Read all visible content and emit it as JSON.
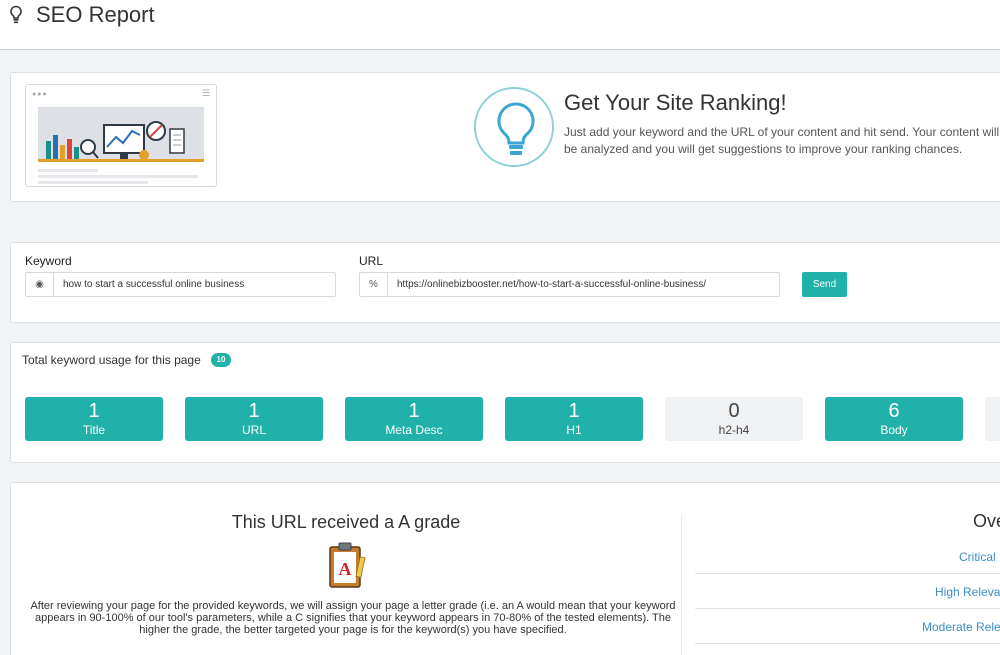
{
  "header": {
    "title": "SEO Report"
  },
  "hero": {
    "title": "Get Your Site Ranking!",
    "description": "Just add your keyword and the URL of your content and hit send. Your content will be analyzed and you will get suggestions to improve your ranking chances."
  },
  "form": {
    "keyword_label": "Keyword",
    "keyword_value": "how to start a successful online business",
    "url_label": "URL",
    "url_value": "https://onlinebizbooster.net/how-to-start-a-successful-online-business/",
    "send_label": "Send"
  },
  "usage": {
    "label": "Total keyword usage for this page",
    "total": "10",
    "items": [
      {
        "count": "1",
        "label": "Title"
      },
      {
        "count": "1",
        "label": "URL"
      },
      {
        "count": "1",
        "label": "Meta Desc"
      },
      {
        "count": "1",
        "label": "H1"
      },
      {
        "count": "0",
        "label": "h2-h4"
      },
      {
        "count": "6",
        "label": "Body"
      }
    ]
  },
  "grade": {
    "title": "This URL received a A grade",
    "letter": "A",
    "description": "After reviewing your page for the provided keywords, we will assign your page a letter grade (i.e. an A would mean that your keyword appears in 90-100% of our tool's parameters, while a C signifies that your keyword appears in 70-80% of the tested elements). The higher the grade, the better targeted your page is for the keyword(s) you have specified."
  },
  "overview": {
    "title": "Ove",
    "rows": [
      "Critical",
      "High Releva",
      "Moderate Rele"
    ]
  },
  "colors": {
    "accent": "#20b2aa",
    "link": "#3a8ec7",
    "tile_inactive": "#f1f2f4"
  }
}
